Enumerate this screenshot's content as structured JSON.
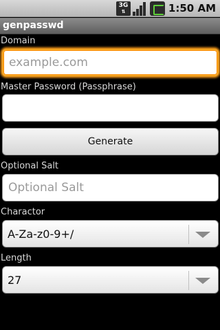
{
  "status_bar": {
    "network_label": "3G",
    "time": "1:50 AM",
    "icons": [
      "network-3g-icon",
      "signal-icon",
      "battery-charging-icon"
    ]
  },
  "app": {
    "title": "genpasswd"
  },
  "domain": {
    "label": "Domain",
    "placeholder": "example.com",
    "value": ""
  },
  "master_password": {
    "label": "Master Password (Passphrase)",
    "value": ""
  },
  "generate_button": {
    "label": "Generate"
  },
  "salt": {
    "label": "Optional Salt",
    "placeholder": "Optional Salt",
    "value": ""
  },
  "charactor": {
    "label": "Charactor",
    "selected": "A-Za-z0-9+/"
  },
  "length": {
    "label": "Length",
    "selected": "27"
  },
  "colors": {
    "focus_accent": "#f5a623",
    "background": "#000000"
  }
}
